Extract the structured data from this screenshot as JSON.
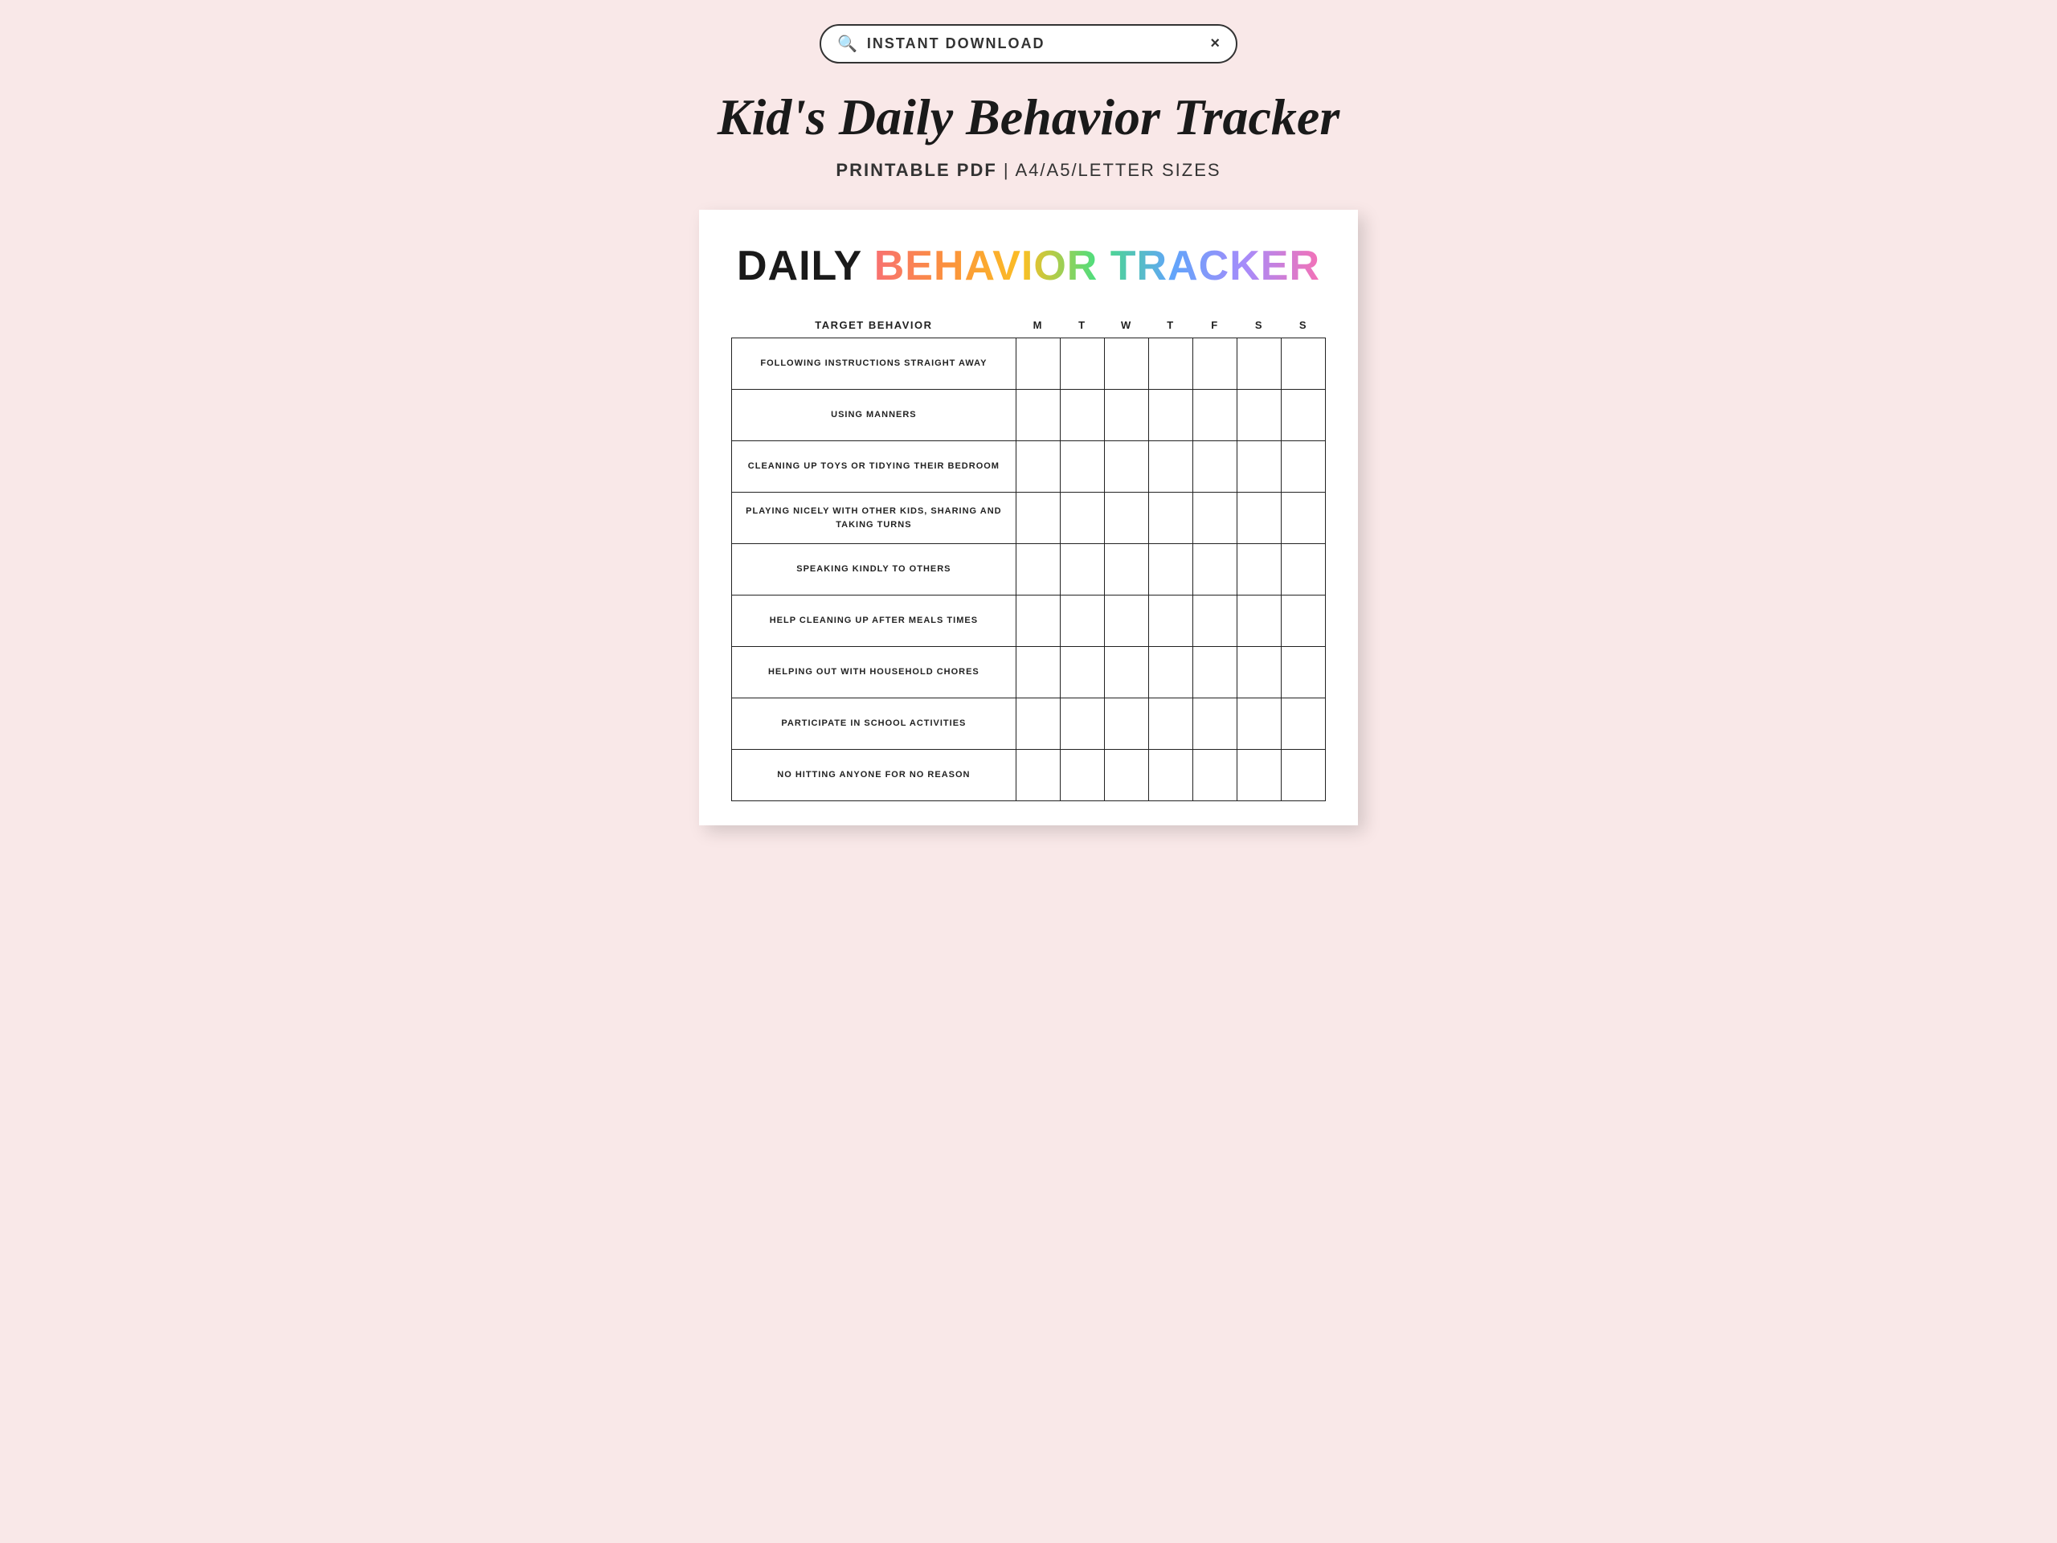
{
  "search": {
    "placeholder": "INSTANT DOWNLOAD",
    "text": "INSTANT DOWNLOAD",
    "close_label": "×"
  },
  "page": {
    "title": "Kid's Daily Behavior Tracker",
    "subtitle_bold": "PRINTABLE PDF",
    "subtitle_rest": " | A4/A5/LETTER SIZES"
  },
  "tracker": {
    "title_plain": "DAILY ",
    "title_rainbow": "BEHAVIOR TRACKER",
    "header": {
      "behavior": "TARGET BEHAVIOR",
      "days": [
        "M",
        "T",
        "W",
        "T",
        "F",
        "S",
        "S"
      ]
    },
    "rows": [
      "FOLLOWING INSTRUCTIONS STRAIGHT AWAY",
      "USING MANNERS",
      "CLEANING UP TOYS OR TIDYING THEIR BEDROOM",
      "PLAYING NICELY WITH OTHER KIDS, SHARING AND TAKING TURNS",
      "SPEAKING KINDLY TO OTHERS",
      "HELP CLEANING UP AFTER MEALS TIMES",
      "HELPING OUT WITH HOUSEHOLD CHORES",
      "PARTICIPATE IN SCHOOL ACTIVITIES",
      "NO HITTING ANYONE FOR NO REASON"
    ]
  }
}
